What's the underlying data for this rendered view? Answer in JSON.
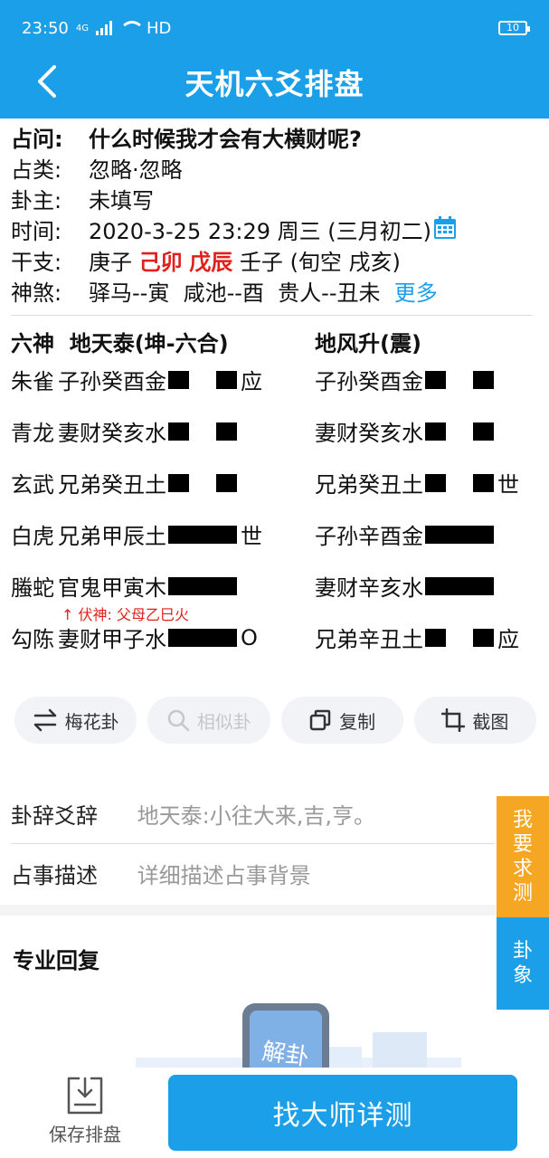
{
  "status_bar": {
    "time": "23:50",
    "network": "4G",
    "hd": "HD",
    "battery": "10"
  },
  "header": {
    "title": "天机六爻排盘"
  },
  "info": {
    "question": {
      "label": "占问:",
      "value": "什么时候我才会有大横财呢?"
    },
    "category": {
      "label": "占类:",
      "value": "忽略·忽略"
    },
    "owner": {
      "label": "卦主:",
      "value": "未填写"
    },
    "time": {
      "label": "时间:",
      "value": "2020-3-25 23:29 周三 (三月初二)"
    },
    "ganzhi": {
      "label": "干支:",
      "year": "庚子",
      "month": "己卯",
      "day": "戊辰",
      "hour": "壬子",
      "xunkong": "(旬空 戌亥)"
    },
    "shensha": {
      "label": "神煞:",
      "value": "驿马--寅  咸池--酉  贵人--丑未",
      "more": "更多"
    }
  },
  "gua": {
    "col_header_left": "六神  地天泰(坤-六合)",
    "col_header_right": "地风升(震)",
    "lines": [
      {
        "god": "朱雀",
        "left": "子孙癸酉金",
        "ltype": "yin",
        "lmark": "应",
        "right": "子孙癸酉金",
        "rtype": "yin",
        "rmark": ""
      },
      {
        "god": "青龙",
        "left": "妻财癸亥水",
        "ltype": "yin",
        "lmark": "",
        "right": "妻财癸亥水",
        "rtype": "yin",
        "rmark": ""
      },
      {
        "god": "玄武",
        "left": "兄弟癸丑土",
        "ltype": "yin",
        "lmark": "",
        "right": "兄弟癸丑土",
        "rtype": "yin",
        "rmark": "世"
      },
      {
        "god": "白虎",
        "left": "兄弟甲辰土",
        "ltype": "yang",
        "lmark": "世",
        "right": "子孙辛酉金",
        "rtype": "yang",
        "rmark": ""
      },
      {
        "god": "螣蛇",
        "left": "官鬼甲寅木",
        "ltype": "yang",
        "lmark": "",
        "right": "妻财辛亥水",
        "rtype": "yang",
        "rmark": ""
      },
      {
        "god": "勾陈",
        "left": "妻财甲子水",
        "ltype": "yang",
        "lmark": "O",
        "right": "兄弟辛丑土",
        "rtype": "yin",
        "rmark": "应"
      }
    ],
    "fushen": "↑ 伏神: 父母乙巳火"
  },
  "tools": [
    {
      "label": "梅花卦",
      "icon": "swap-icon",
      "enabled": true
    },
    {
      "label": "相似卦",
      "icon": "search-icon",
      "enabled": false
    },
    {
      "label": "复制",
      "icon": "copy-icon",
      "enabled": true
    },
    {
      "label": "截图",
      "icon": "crop-icon",
      "enabled": true
    }
  ],
  "guaci": {
    "label": "卦辞爻辞",
    "value": "地天泰:小往大来,吉,亨。"
  },
  "description": {
    "label": "占事描述",
    "placeholder": "详细描述占事背景"
  },
  "side_buttons": {
    "request": "我要求测",
    "image": "卦象"
  },
  "reply": {
    "title": "专业回复",
    "illus_text": "解卦"
  },
  "bottom": {
    "save_label": "保存排盘",
    "cta_label": "找大师详测"
  },
  "colors": {
    "accent": "#1a9fe8",
    "orange": "#f5a623",
    "red": "#e0201b"
  }
}
